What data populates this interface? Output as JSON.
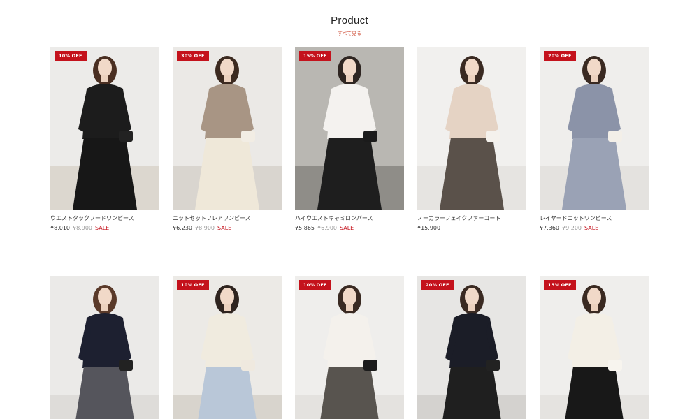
{
  "header": {
    "title": "Product",
    "see_all": "すべて見る"
  },
  "products": [
    {
      "badge": "10% OFF",
      "name": "ウエストタックフードワンピース",
      "price": "¥8,010",
      "original": "¥8,900",
      "sale": "SALE",
      "top": "#1c1c1c",
      "bottom": "#171717",
      "bg": "#ecebe9",
      "wall": "#dcd7cf",
      "hair": "#4a2f22",
      "bag": "#222222"
    },
    {
      "badge": "30% OFF",
      "name": "ニットセットフレアワンピース",
      "price": "¥6,230",
      "original": "¥8,900",
      "sale": "SALE",
      "top": "#a89584",
      "bottom": "#efe8d9",
      "bg": "#ebe9e6",
      "wall": "#d9d5cf",
      "hair": "#3c2a20",
      "bag": "#f2ede4"
    },
    {
      "badge": "15% OFF",
      "name": "ハイウエストキャミロンパース",
      "price": "¥5,865",
      "original": "¥6,900",
      "sale": "SALE",
      "top": "#f4f2ef",
      "bottom": "#1e1e1e",
      "bg": "#b9b7b2",
      "wall": "#8f8d88",
      "hair": "#2e2521",
      "bag": "#1b1b1b"
    },
    {
      "badge": "",
      "name": "ノーカラーフェイクファーコート",
      "price": "¥15,900",
      "original": "",
      "sale": "",
      "top": "#e5d3c4",
      "bottom": "#5a514a",
      "bg": "#f1f0ee",
      "wall": "#e6e4e1",
      "hair": "#3a2a22",
      "bag": "#f4f1ec"
    },
    {
      "badge": "20% OFF",
      "name": "レイヤードニットワンピース",
      "price": "¥7,360",
      "original": "¥9,200",
      "sale": "SALE",
      "top": "#8b93a8",
      "bottom": "#9aa2b5",
      "bg": "#efeeec",
      "wall": "#e4e2df",
      "hair": "#3a2a22",
      "bag": "#f3efe8"
    },
    {
      "badge": "",
      "name": "",
      "price": "",
      "original": "",
      "sale": "",
      "top": "#1d2030",
      "bottom": "#55555c",
      "bg": "#ebeae8",
      "wall": "#dedcd9",
      "hair": "#5a3a2a",
      "bag": "#222222"
    },
    {
      "badge": "10% OFF",
      "name": "",
      "price": "",
      "original": "",
      "sale": "",
      "top": "#f0ebdf",
      "bottom": "#b9c7d8",
      "bg": "#eceae6",
      "wall": "#d8d4cd",
      "hair": "#2f241f",
      "bag": "#efe9df"
    },
    {
      "badge": "10% OFF",
      "name": "",
      "price": "",
      "original": "",
      "sale": "",
      "top": "#f4f1ec",
      "bottom": "#58544f",
      "bg": "#efeeec",
      "wall": "#e4e2df",
      "hair": "#3a2a22",
      "bag": "#1b1b1b"
    },
    {
      "badge": "20% OFF",
      "name": "",
      "price": "",
      "original": "",
      "sale": "",
      "top": "#1b1d27",
      "bottom": "#1f1f1f",
      "bg": "#e7e6e4",
      "wall": "#d4d2cf",
      "hair": "#3a2a22",
      "bag": "#222222"
    },
    {
      "badge": "15% OFF",
      "name": "",
      "price": "",
      "original": "",
      "sale": "",
      "top": "#f3efe6",
      "bottom": "#181818",
      "bg": "#efeeec",
      "wall": "#e5e3e0",
      "hair": "#3a2a22",
      "bag": "#f7f4ee"
    }
  ]
}
